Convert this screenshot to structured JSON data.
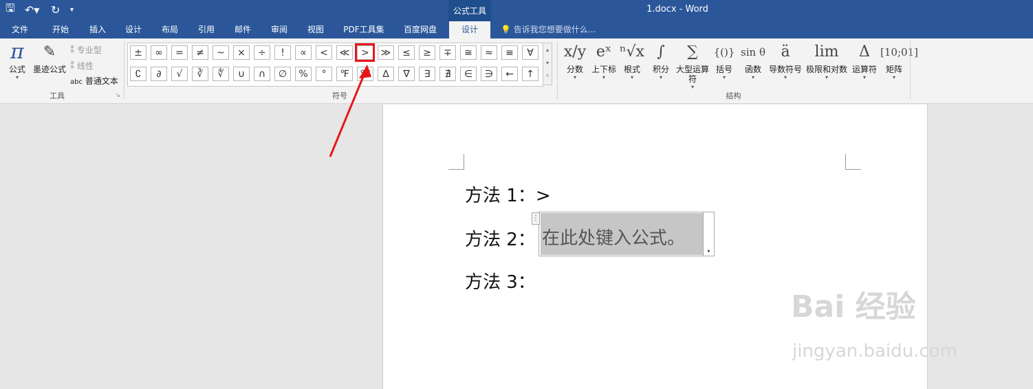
{
  "window": {
    "context_group": "公式工具",
    "doc_title": "1.docx - Word"
  },
  "tabs": [
    {
      "label": "文件"
    },
    {
      "label": "开始"
    },
    {
      "label": "插入"
    },
    {
      "label": "设计"
    },
    {
      "label": "布局"
    },
    {
      "label": "引用"
    },
    {
      "label": "邮件"
    },
    {
      "label": "审阅"
    },
    {
      "label": "视图"
    },
    {
      "label": "PDF工具集"
    },
    {
      "label": "百度网盘"
    },
    {
      "label": "设计",
      "active": true
    }
  ],
  "tell_me": "告诉我您想要做什么...",
  "tools_group": {
    "label": "工具",
    "equation": "公式",
    "ink_equation": "墨迹公式",
    "professional": "专业型",
    "linear": "线性",
    "normal_text": "普通文本",
    "abc": "abc"
  },
  "symbols_group": {
    "label": "符号",
    "row1": [
      "±",
      "∞",
      "=",
      "≠",
      "~",
      "×",
      "÷",
      "!",
      "∝",
      "<",
      "≪",
      ">",
      "≫",
      "≤",
      "≥",
      "∓",
      "≅",
      "≈",
      "≡",
      "∀"
    ],
    "row2": [
      "∁",
      "∂",
      "√",
      "∛",
      "∜",
      "∪",
      "∩",
      "∅",
      "%",
      "°",
      "℉",
      "℃",
      "∆",
      "∇",
      "∃",
      "∄",
      "∈",
      "∋",
      "←",
      "↑"
    ]
  },
  "structures_group": {
    "label": "结构",
    "items": [
      {
        "label": "分数",
        "glyph": "x/y"
      },
      {
        "label": "上下标",
        "glyph": "eˣ"
      },
      {
        "label": "根式",
        "glyph": "ⁿ√x"
      },
      {
        "label": "积分",
        "glyph": "∫"
      },
      {
        "label": "大型运算符",
        "glyph": "∑"
      },
      {
        "label": "括号",
        "glyph": "{()}"
      },
      {
        "label": "函数",
        "glyph": "sin θ"
      },
      {
        "label": "导数符号",
        "glyph": "ä"
      },
      {
        "label": "极限和对数",
        "glyph": "lim"
      },
      {
        "label": "运算符",
        "glyph": "Δ"
      },
      {
        "label": "矩阵",
        "glyph": "[10;01]"
      }
    ]
  },
  "document": {
    "lines": [
      {
        "label": "方法 1：",
        "value": ">"
      },
      {
        "label": "方法 2：",
        "value": ""
      },
      {
        "label": "方法 3：",
        "value": ""
      }
    ],
    "equation_placeholder": "在此处键入公式。"
  },
  "watermark": {
    "text": "Bai 经验",
    "sub": "jingyan.baidu.com"
  },
  "colors": {
    "ribbon_blue": "#2b579a",
    "highlight_red": "#e8141b"
  }
}
